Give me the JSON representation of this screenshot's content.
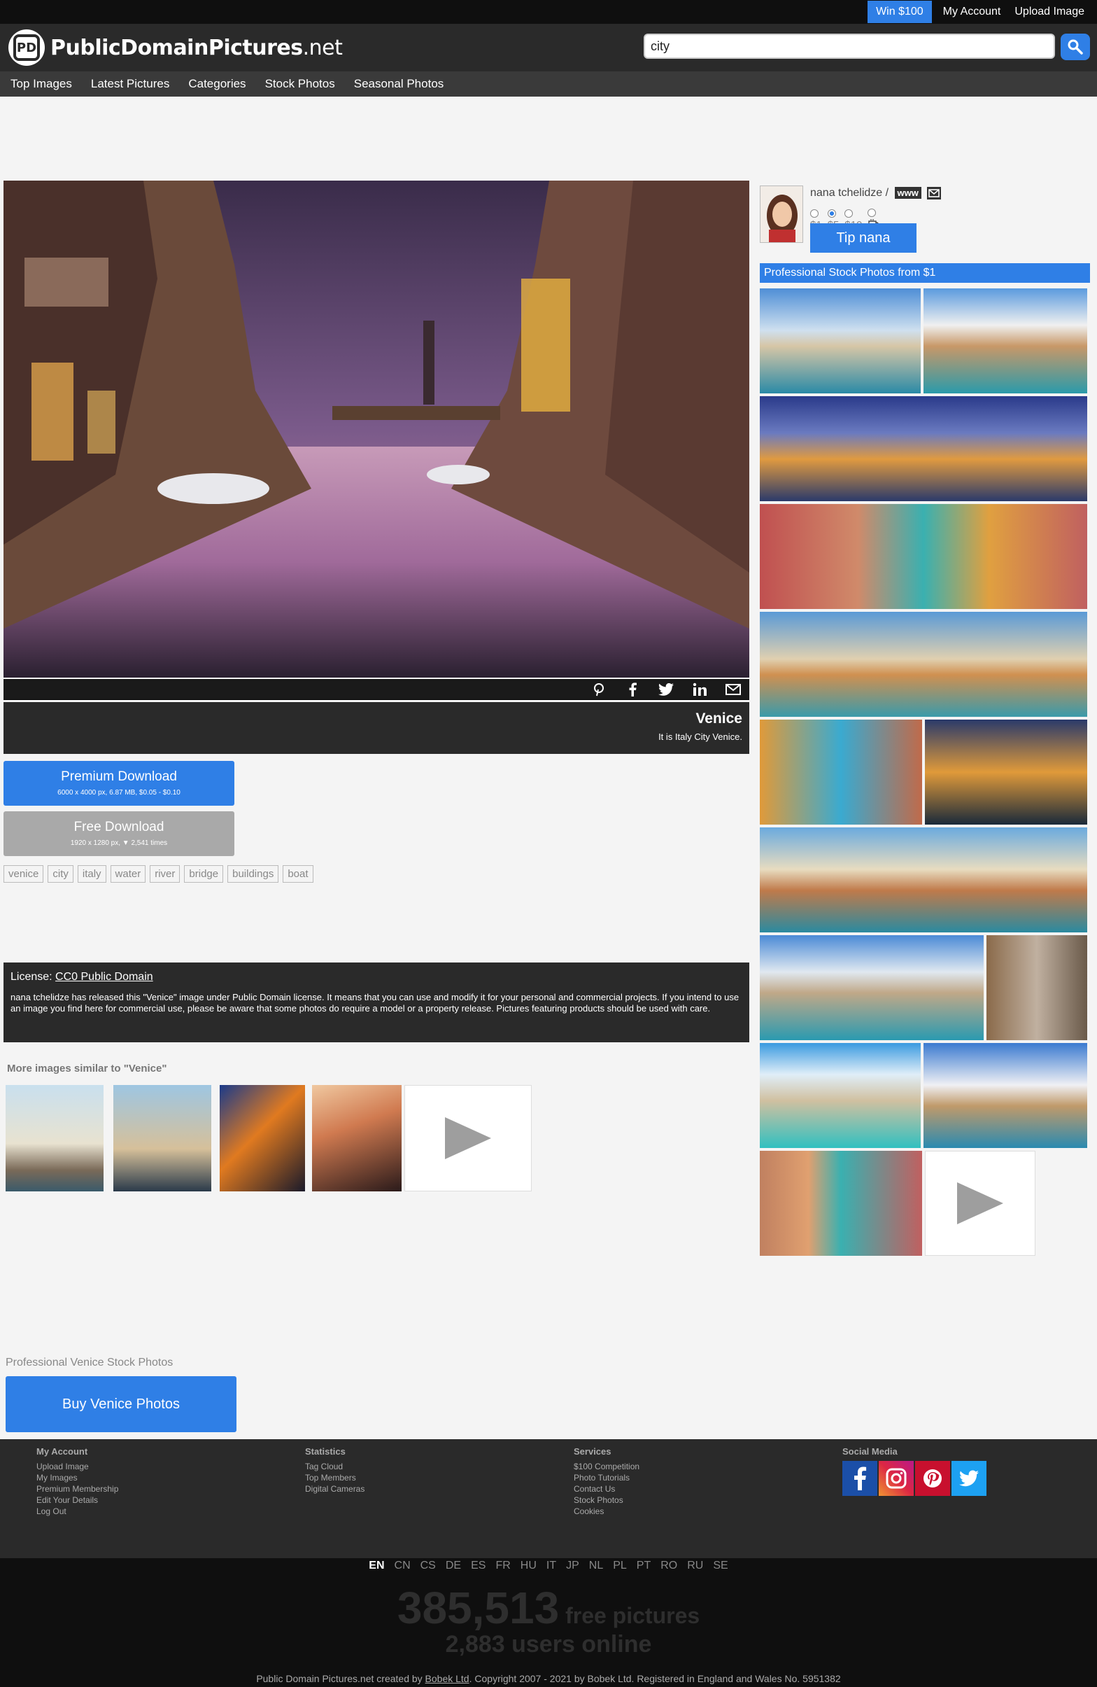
{
  "topbar": {
    "win": "Win $100",
    "my_account": "My Account",
    "upload": "Upload Image"
  },
  "header": {
    "logo_bold": "PublicDomain",
    "logo_bold2": "Pictures",
    "logo_suffix": ".net",
    "search_value": "city"
  },
  "nav": [
    "Top Images",
    "Latest Pictures",
    "Categories",
    "Stock Photos",
    "Seasonal Photos"
  ],
  "image": {
    "title": "Venice",
    "description": "It is Italy City Venice."
  },
  "share": [
    "pinterest-icon",
    "facebook-icon",
    "twitter-icon",
    "linkedin-icon",
    "mail-icon"
  ],
  "premium": {
    "label": "Premium Download",
    "sub": "6000 x 4000 px, 6.87 MB, $0.05 - $0.10"
  },
  "free": {
    "label": "Free Download",
    "sub": "1920 x 1280 px, ▼ 2,541 times"
  },
  "tags": [
    "venice",
    "city",
    "italy",
    "water",
    "river",
    "bridge",
    "buildings",
    "boat"
  ],
  "license": {
    "label": "License:",
    "link": "CC0 Public Domain",
    "text": "nana tchelidze has released this \"Venice\" image under Public Domain license. It means that you can use and modify it for your personal and commercial projects. If you intend to use an image you find here for commercial use, please be aware that some photos do require a model or a property release. Pictures featuring products should be used with care."
  },
  "similar": {
    "heading": "More images similar to \"Venice\""
  },
  "pro_stock": {
    "heading": "Professional Venice Stock Photos",
    "button": "Buy Venice Photos"
  },
  "author": {
    "name": "nana tchelidze",
    "sep": "/",
    "www": "www",
    "tip_button": "Tip nana",
    "tips": [
      "$1",
      "$5",
      "$10",
      ""
    ]
  },
  "sidebar": {
    "heading": "Professional Stock Photos from $1"
  },
  "footer": {
    "cols": [
      {
        "title": "My Account",
        "links": [
          "Upload Image",
          "My Images",
          "Premium Membership",
          "Edit Your Details",
          "Log Out"
        ]
      },
      {
        "title": "Statistics",
        "links": [
          "Tag Cloud",
          "Top Members",
          "Digital Cameras"
        ]
      },
      {
        "title": "Services",
        "links": [
          "$100 Competition",
          "Photo Tutorials",
          "Contact Us",
          "Stock Photos",
          "Cookies"
        ]
      },
      {
        "title": "Social Media",
        "links": []
      }
    ]
  },
  "bottom": {
    "languages": [
      "EN",
      "CN",
      "CS",
      "DE",
      "ES",
      "FR",
      "HU",
      "IT",
      "JP",
      "NL",
      "PL",
      "PT",
      "RO",
      "RU",
      "SE"
    ],
    "count": "385,513",
    "count_label": "free pictures",
    "online": "2,883 users online",
    "copyright_pre": "Public Domain Pictures.net created by",
    "copyright_link": "Bobek Ltd",
    "copyright_post": ". Copyright 2007 - 2021 by Bobek Ltd. Registered in England and Wales No. 5951382"
  },
  "colors": {
    "accent": "#2f7fe6",
    "dark": "#2a2a2a",
    "nav": "#3a3a3a"
  }
}
